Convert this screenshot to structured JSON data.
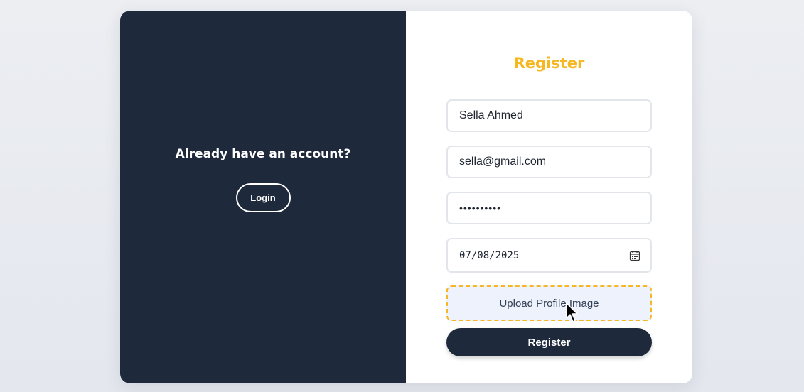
{
  "sidebar": {
    "prompt": "Already have an account?",
    "login_label": "Login"
  },
  "form": {
    "title": "Register",
    "name_value": "Sella Ahmed",
    "email_value": "sella@gmail.com",
    "password_value": "••••••••••",
    "date_value": "07/08/2025",
    "upload_label": "Upload Profile Image",
    "submit_label": "Register"
  },
  "icons": {
    "date_picker": "calendar-icon",
    "pointer": "mouse-cursor-icon"
  },
  "colors": {
    "dark_panel": "#1e293b",
    "accent": "#f5b822",
    "upload_bg": "#eef2fc"
  }
}
